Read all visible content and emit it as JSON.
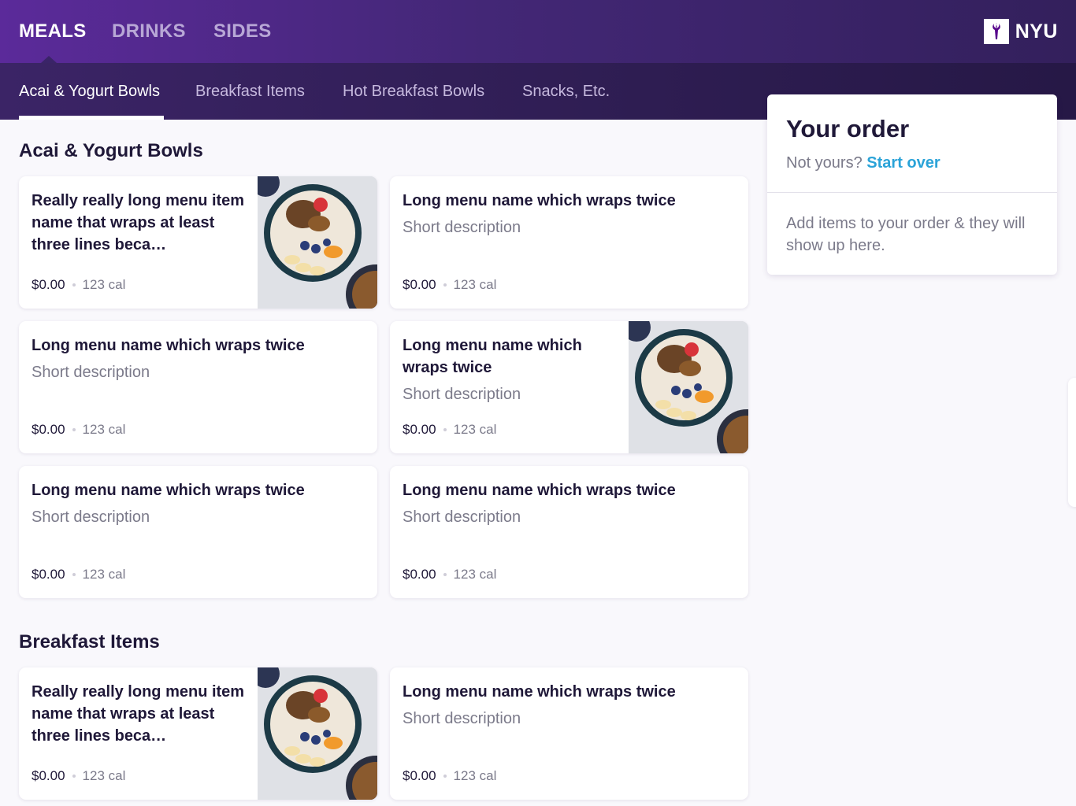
{
  "top_nav": {
    "tabs": [
      {
        "label": "MEALS",
        "active": true
      },
      {
        "label": "DRINKS",
        "active": false
      },
      {
        "label": "SIDES",
        "active": false
      }
    ],
    "logo_text": "NYU",
    "logo_icon": "torch-icon"
  },
  "sub_nav": {
    "tabs": [
      {
        "label": "Acai & Yogurt Bowls",
        "active": true
      },
      {
        "label": "Breakfast Items",
        "active": false
      },
      {
        "label": "Hot Breakfast Bowls",
        "active": false
      },
      {
        "label": "Snacks, Etc.",
        "active": false
      }
    ]
  },
  "sections": [
    {
      "title": "Acai & Yogurt Bowls",
      "items": [
        {
          "name": "Really really long menu item name that wraps at least three lines beca…",
          "description": "",
          "price": "$0.00",
          "calories": "123 cal",
          "image": "acai-bowl-photo"
        },
        {
          "name": "Long menu name which wraps twice",
          "description": "Short description",
          "price": "$0.00",
          "calories": "123 cal",
          "image": ""
        },
        {
          "name": "Long menu name which wraps twice",
          "description": "Short description",
          "price": "$0.00",
          "calories": "123 cal",
          "image": ""
        },
        {
          "name": "Long menu name which wraps twice",
          "description": "Short description",
          "price": "$0.00",
          "calories": "123 cal",
          "image": "acai-bowl-photo"
        },
        {
          "name": "Long menu name which wraps twice",
          "description": "Short description",
          "price": "$0.00",
          "calories": "123 cal",
          "image": ""
        },
        {
          "name": "Long menu name which wraps twice",
          "description": "Short description",
          "price": "$0.00",
          "calories": "123 cal",
          "image": ""
        }
      ]
    },
    {
      "title": "Breakfast Items",
      "items": [
        {
          "name": "Really really long menu item name that wraps at least three lines beca…",
          "description": "",
          "price": "$0.00",
          "calories": "123 cal",
          "image": "acai-bowl-photo"
        },
        {
          "name": "Long menu name which wraps twice",
          "description": "Short description",
          "price": "$0.00",
          "calories": "123 cal",
          "image": ""
        }
      ]
    }
  ],
  "order": {
    "title": "Your order",
    "not_yours_text": "Not yours?",
    "start_over_label": "Start over",
    "empty_message": "Add items to your order & they will show up here."
  },
  "colors": {
    "brand_purple": "#57068c",
    "link_blue": "#2aa3d8"
  }
}
